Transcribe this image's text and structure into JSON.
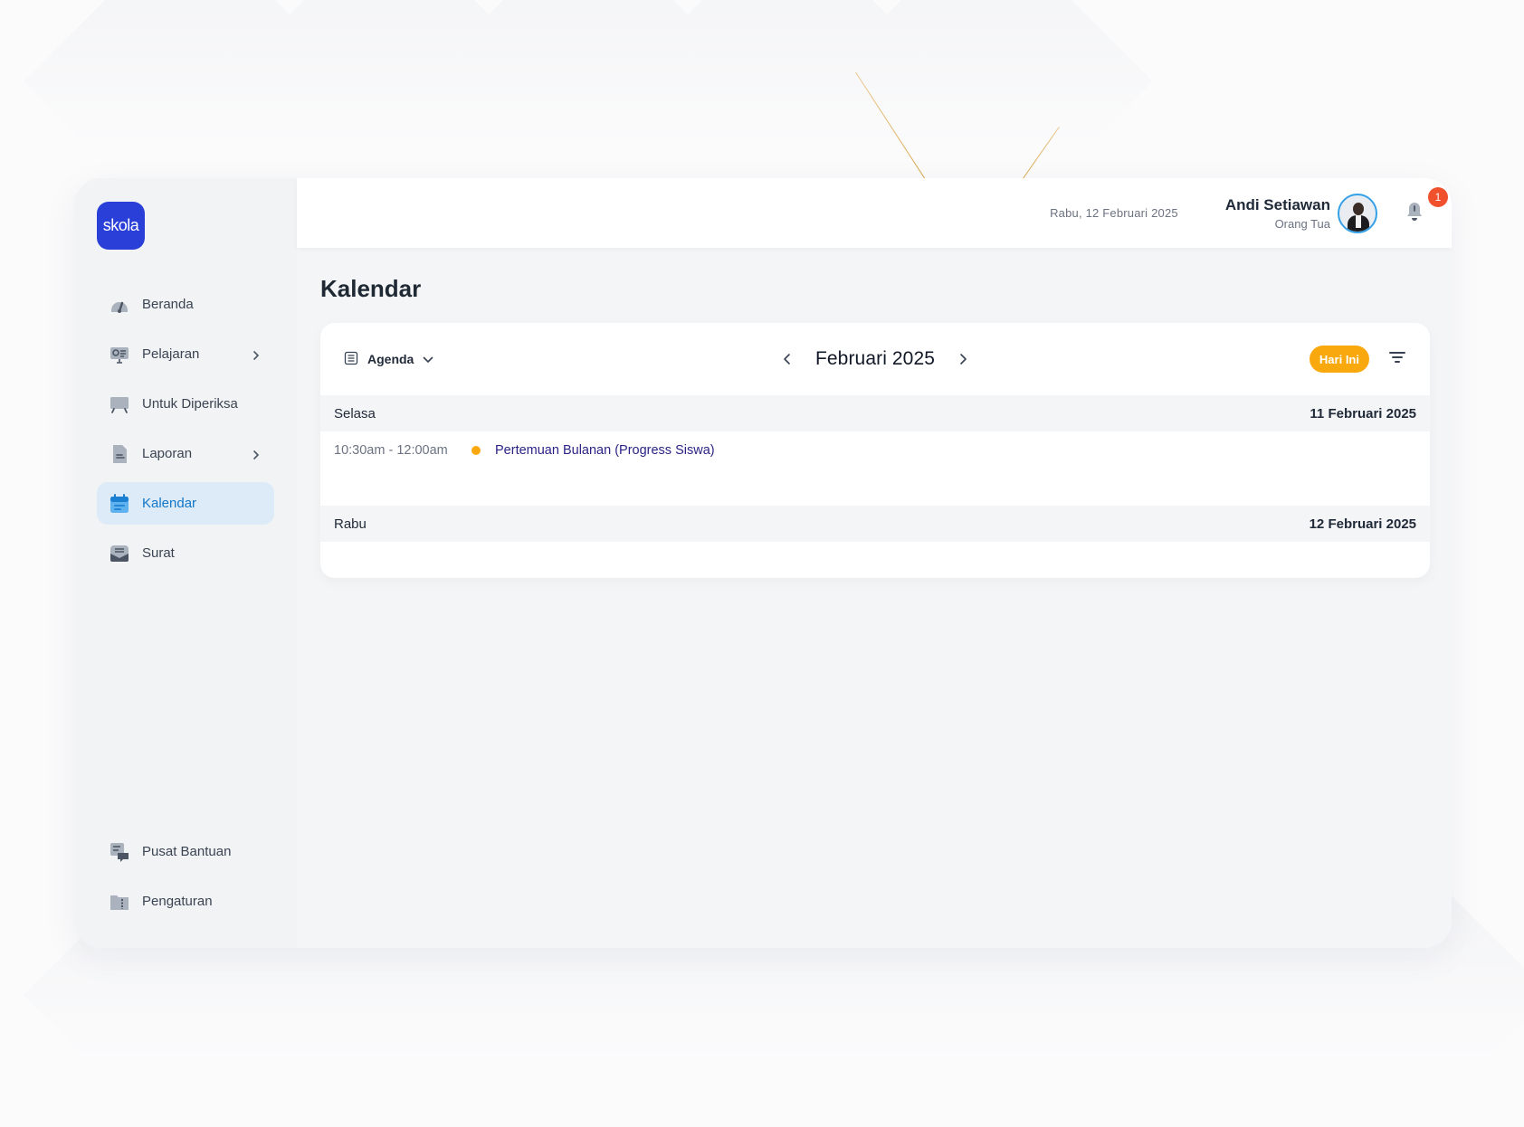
{
  "app": {
    "logo_text": "skola"
  },
  "sidebar": {
    "items": [
      {
        "label": "Beranda",
        "icon": "dashboard-gauge-icon",
        "has_submenu": false,
        "active": false
      },
      {
        "label": "Pelajaran",
        "icon": "presentation-board-icon",
        "has_submenu": true,
        "active": false
      },
      {
        "label": "Untuk Diperiksa",
        "icon": "review-board-icon",
        "has_submenu": false,
        "active": false
      },
      {
        "label": "Laporan",
        "icon": "report-document-icon",
        "has_submenu": true,
        "active": false
      },
      {
        "label": "Kalendar",
        "icon": "calendar-icon",
        "has_submenu": false,
        "active": true
      },
      {
        "label": "Surat",
        "icon": "mail-inbox-icon",
        "has_submenu": false,
        "active": false
      }
    ],
    "bottom_items": [
      {
        "label": "Pusat Bantuan",
        "icon": "help-chat-icon"
      },
      {
        "label": "Pengaturan",
        "icon": "settings-folder-icon"
      }
    ]
  },
  "header": {
    "date": "Rabu, 12 Februari 2025",
    "user_name": "Andi Setiawan",
    "user_role": "Orang Tua",
    "notification_count": "1"
  },
  "page": {
    "title": "Kalendar"
  },
  "calendar": {
    "view_label": "Agenda",
    "month_label": "Februari 2025",
    "today_label": "Hari Ini",
    "days": [
      {
        "day_name": "Selasa",
        "date": "11 Februari 2025",
        "events": [
          {
            "time": "10:30am - 12:00am",
            "title": "Pertemuan Bulanan (Progress Siswa)",
            "color": "#f9a90e"
          }
        ]
      },
      {
        "day_name": "Rabu",
        "date": "12 Februari 2025",
        "events": []
      }
    ]
  },
  "colors": {
    "brand": "#2a3fd8",
    "active_nav_bg": "#dcebf7",
    "active_nav_text": "#1276c9",
    "accent_orange": "#f9a90e",
    "badge_red": "#f0512c",
    "event_title": "#2b2384"
  }
}
